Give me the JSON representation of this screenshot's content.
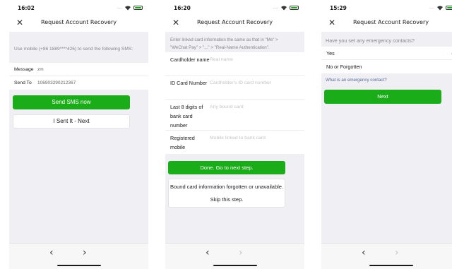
{
  "icons": {
    "close": "close-icon",
    "back": "chevron-left-icon",
    "forward": "chevron-right-icon",
    "check": "checkmark-icon",
    "wifi": "wifi-icon",
    "battery": "battery-icon"
  },
  "colors": {
    "accent": "#1aad19",
    "link": "#576b95",
    "background": "#efeff4"
  },
  "glyphs": {
    "close": "✕",
    "back": "‹",
    "forward": "›",
    "check": "✓"
  },
  "screen1": {
    "status_time": "16:02",
    "title": "Request Account Recovery",
    "instruction": "Use mobile (+86 1889****426) to send the following SMS:",
    "rows": [
      {
        "label": "Message",
        "value": "zm"
      },
      {
        "label": "Send To",
        "value": "106903290212367"
      }
    ],
    "primary_button": "Send SMS now",
    "secondary_button": "I Sent It - Next"
  },
  "screen2": {
    "status_time": "16:20",
    "title": "Request Account Recovery",
    "instruction": "Enter linked card information the same as that in \"Me\" > \"WeChat Pay\" > \"...\" > \"Real-Name Authentication\".",
    "fields": [
      {
        "label": "Cardholder name",
        "placeholder": "Real name"
      },
      {
        "label": "ID Card Number",
        "placeholder": "Cardholder's ID card number"
      },
      {
        "label": "Last 8 digits of bank card number",
        "placeholder": "Any bound card"
      },
      {
        "label": "Registered mobile",
        "placeholder": "Mobile linked to bank card"
      }
    ],
    "primary_button": "Done. Go to next step.",
    "secondary_button": "Bound card information forgotten or unavailable. Skip this step."
  },
  "screen3": {
    "status_time": "15:29",
    "title": "Request Account Recovery",
    "question": "Have you set any emergency contacts?",
    "options": [
      {
        "label": "Yes",
        "selected": true
      },
      {
        "label": "No or Forgotten",
        "selected": false
      }
    ],
    "link": "What is an emergency contact?",
    "primary_button": "Next"
  }
}
